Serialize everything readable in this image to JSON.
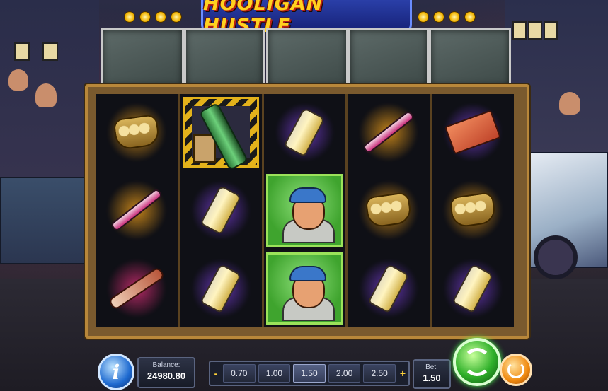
{
  "game": {
    "title": "HOOLIGAN HUSTLE"
  },
  "reels": [
    [
      "brass-knuckles",
      "crowbar",
      "spiked-bat"
    ],
    [
      "molotov-box",
      "bottle",
      "bottle"
    ],
    [
      "bottle",
      "hooligan-wild",
      "hooligan-wild"
    ],
    [
      "crowbar",
      "brass-knuckles",
      "bottle"
    ],
    [
      "brick",
      "brass-knuckles",
      "bottle"
    ]
  ],
  "controls": {
    "info_label": "i",
    "balance_label": "Balance:",
    "balance_value": "24980.80",
    "bet_minus": "-",
    "bet_plus": "+",
    "bet_options": [
      "0.70",
      "1.00",
      "1.50",
      "2.00",
      "2.50"
    ],
    "bet_selected": "1.50",
    "bet_label": "Bet:",
    "bet_value": "1.50"
  },
  "colors": {
    "splash_purple": "#7a3fd8",
    "splash_orange": "#f0a01a",
    "splash_pink": "#e0307a",
    "wild_green": "#3fa42e",
    "frame_gold": "#b8873a"
  }
}
